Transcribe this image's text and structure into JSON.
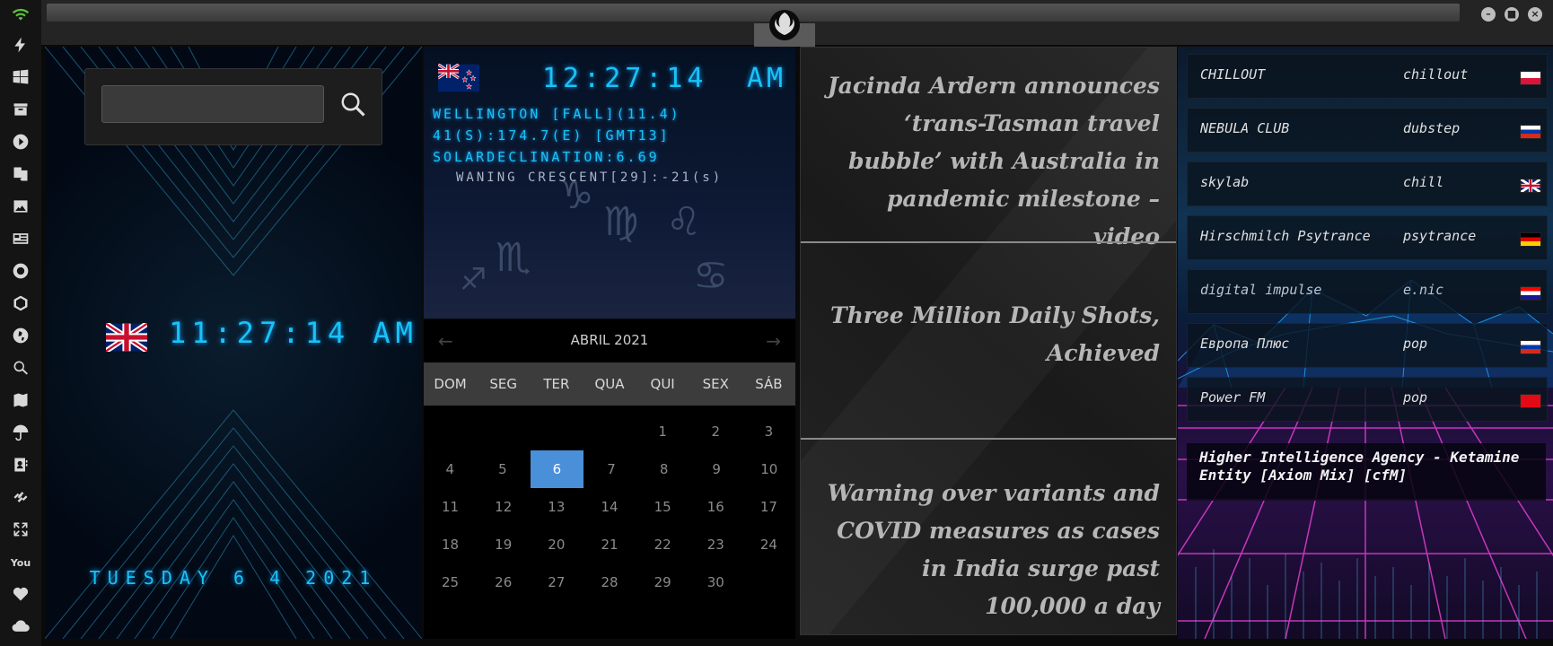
{
  "sidebar": {
    "icons": [
      "wifi-icon",
      "flash-icon",
      "windows-icon",
      "archive-icon",
      "play-icon",
      "translate-icon",
      "image-icon",
      "news-icon",
      "sun-icon",
      "network-icon",
      "globe-icon",
      "search-icon",
      "map-icon",
      "umbrella-icon",
      "contacts-icon",
      "link-icon",
      "expand-icon",
      "youtube-icon",
      "heart-icon",
      "cloud-icon"
    ]
  },
  "topbar": {
    "logo": "rebel-alliance-logo",
    "minimize": "–",
    "maximize": "■",
    "close": "×"
  },
  "clock_panel": {
    "search_placeholder": "",
    "uk_time": "11:27:14  AM",
    "date": "TUESDAY 6 4 2021"
  },
  "nz_panel": {
    "time": "12:27:14",
    "ampm": "AM",
    "line1": "WELLINGTON [FALL](11.4)",
    "line2": "41(S):174.7(E) [GMT13]",
    "line3": "SOLARDECLINATION:6.69",
    "moon": "WANING CRESCENT[29]:-21(s)"
  },
  "calendar": {
    "month": "ABRIL 2021",
    "prev": "←",
    "next": "→",
    "weekdays": [
      "DOM",
      "SEG",
      "TER",
      "QUA",
      "QUI",
      "SEX",
      "SÁB"
    ],
    "weeks": [
      [
        "",
        "",
        "",
        "",
        "1",
        "2",
        "3"
      ],
      [
        "4",
        "5",
        "6",
        "7",
        "8",
        "9",
        "10"
      ],
      [
        "11",
        "12",
        "13",
        "14",
        "15",
        "16",
        "17"
      ],
      [
        "18",
        "19",
        "20",
        "21",
        "22",
        "23",
        "24"
      ],
      [
        "25",
        "26",
        "27",
        "28",
        "29",
        "30",
        ""
      ]
    ],
    "today": "6"
  },
  "news": {
    "items": [
      "Jacinda Ardern announces ‘trans-Tasman travel bubble’ with Australia in pandemic milestone – video",
      "Three Million Daily Shots, Achieved",
      "Warning over variants and COVID measures as cases in India surge past 100,000 a day"
    ]
  },
  "radio": {
    "stations": [
      {
        "name": "CHILLOUT",
        "genre": "chillout",
        "flag": "poland"
      },
      {
        "name": "NEBULA CLUB",
        "genre": "dubstep",
        "flag": "russia"
      },
      {
        "name": "skylab",
        "genre": "chill",
        "flag": "uk"
      },
      {
        "name": "Hirschmilch Psytrance",
        "genre": "psytrance",
        "flag": "germany"
      },
      {
        "name": "digital impulse",
        "genre": "e.nic",
        "flag": "croatia"
      },
      {
        "name": "Европа Плюс",
        "genre": "pop",
        "flag": "russia"
      },
      {
        "name": "Power FM",
        "genre": "pop",
        "flag": "turkey"
      }
    ],
    "now_playing": "Higher Intelligence Agency - Ketamine Entity [Axiom Mix] [cfM]"
  }
}
